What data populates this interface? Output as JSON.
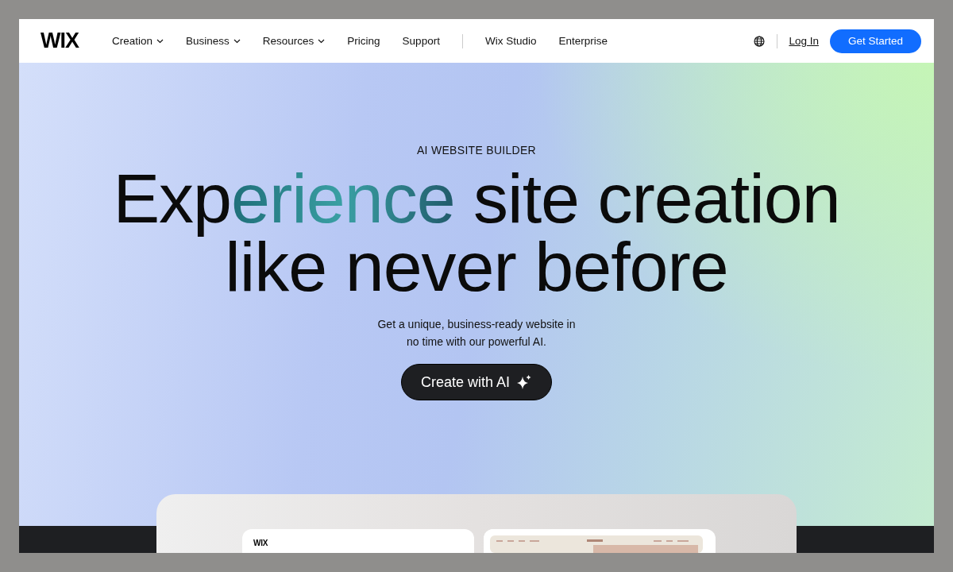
{
  "nav": {
    "logo": "WIX",
    "items": [
      {
        "label": "Creation",
        "dropdown": true
      },
      {
        "label": "Business",
        "dropdown": true
      },
      {
        "label": "Resources",
        "dropdown": true
      },
      {
        "label": "Pricing",
        "dropdown": false
      },
      {
        "label": "Support",
        "dropdown": false
      }
    ],
    "secondary_items": [
      {
        "label": "Wix Studio"
      },
      {
        "label": "Enterprise"
      }
    ],
    "login": "Log In",
    "cta": "Get Started"
  },
  "hero": {
    "eyebrow": "AI WEBSITE BUILDER",
    "headline_lines": [
      [
        {
          "text": "Exp",
          "highlight": false
        },
        {
          "text": "erience",
          "highlight": true
        },
        {
          "text": " site creation",
          "highlight": false
        }
      ],
      [
        {
          "text": "like never before",
          "highlight": false
        }
      ]
    ],
    "subtitle_lines": [
      "Get a unique, business-ready website in",
      "no time with our powerful AI."
    ],
    "button": "Create with AI"
  },
  "preview": {
    "left_card_logo": "WIX"
  }
}
